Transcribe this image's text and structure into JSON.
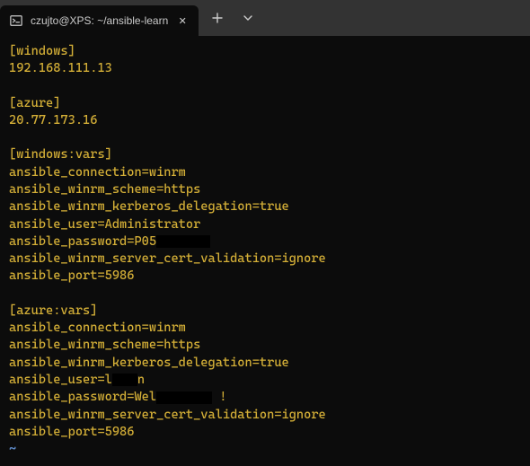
{
  "tab": {
    "title": "czujto@XPS: ~/ansible-learn"
  },
  "content": {
    "lines": [
      {
        "type": "text",
        "value": "[windows]"
      },
      {
        "type": "text",
        "value": "192.168.111.13"
      },
      {
        "type": "empty"
      },
      {
        "type": "text",
        "value": "[azure]"
      },
      {
        "type": "text",
        "value": "20.77.173.16"
      },
      {
        "type": "empty"
      },
      {
        "type": "text",
        "value": "[windows:vars]"
      },
      {
        "type": "text",
        "value": "ansible_connection=winrm"
      },
      {
        "type": "text",
        "value": "ansible_winrm_scheme=https"
      },
      {
        "type": "text",
        "value": "ansible_winrm_kerberos_delegation=true"
      },
      {
        "type": "text",
        "value": "ansible_user=Administrator"
      },
      {
        "type": "redacted",
        "prefix": "ansible_password=P05",
        "redact_width": 60,
        "suffix": ""
      },
      {
        "type": "text",
        "value": "ansible_winrm_server_cert_validation=ignore"
      },
      {
        "type": "text",
        "value": "ansible_port=5986"
      },
      {
        "type": "empty"
      },
      {
        "type": "text",
        "value": "[azure:vars]"
      },
      {
        "type": "text",
        "value": "ansible_connection=winrm"
      },
      {
        "type": "text",
        "value": "ansible_winrm_scheme=https"
      },
      {
        "type": "text",
        "value": "ansible_winrm_kerberos_delegation=true"
      },
      {
        "type": "redacted",
        "prefix": "ansible_user=l",
        "redact_width": 28,
        "suffix": "n"
      },
      {
        "type": "redacted",
        "prefix": "ansible_password=Wel",
        "redact_width": 62,
        "suffix": " !"
      },
      {
        "type": "text",
        "value": "ansible_winrm_server_cert_validation=ignore"
      },
      {
        "type": "text",
        "value": "ansible_port=5986"
      },
      {
        "type": "tilde",
        "value": "~"
      }
    ]
  }
}
